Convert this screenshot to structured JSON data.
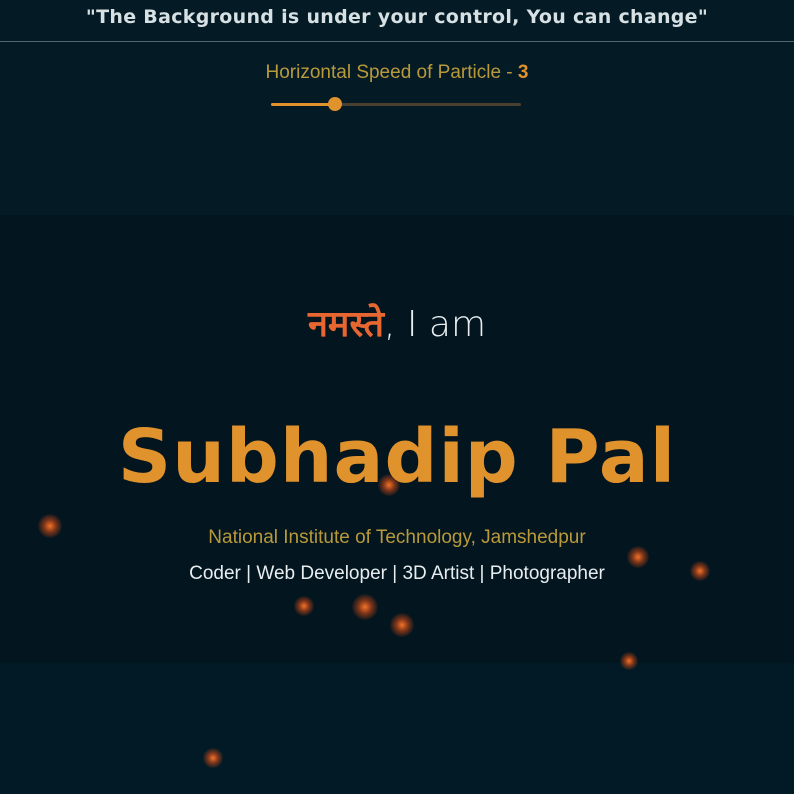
{
  "header": {
    "quote": "\"The Background is under your control, You can change\""
  },
  "speed_control": {
    "label": "Horizontal Speed of Particle - ",
    "value": "3",
    "fill_fraction": 0.25
  },
  "hero": {
    "greeting_word": "नमस्ते",
    "greeting_rest": ", I am",
    "name": "Subhadip Pal",
    "institute": "National Institute of Technology, Jamshedpur",
    "roles": "Coder | Web Developer | 3D Artist | Photographer"
  },
  "colors": {
    "accent": "#e0922d",
    "greeting_accent": "#e8662f",
    "subtle_text": "#b99a3a",
    "background": "#041b26"
  }
}
